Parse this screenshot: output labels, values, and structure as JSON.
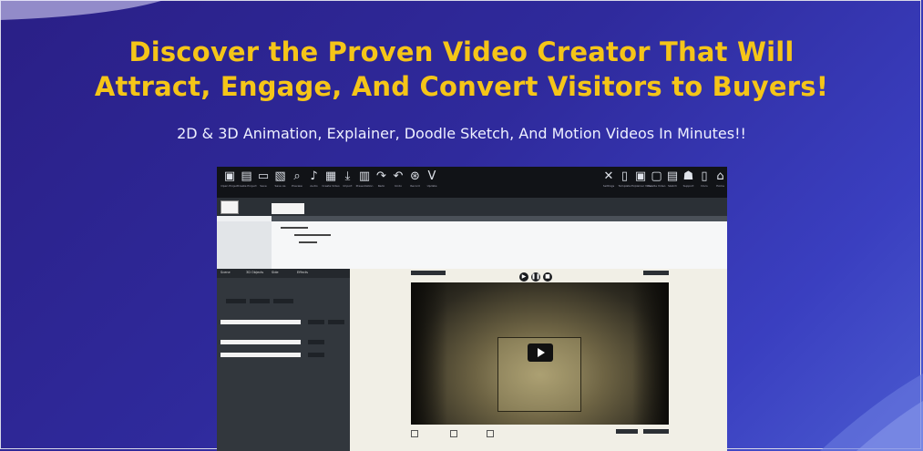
{
  "hero": {
    "title_line1": "Discover the Proven Video Creator That Will",
    "title_line2": "Attract, Engage, And Convert Visitors to Buyers!",
    "subtitle": "2D & 3D Animation, Explainer, Doodle Sketch, And Motion Videos In Minutes!!"
  },
  "colors": {
    "title": "#f5c518",
    "background_start": "#2a1f86",
    "background_end": "#4a5ad0",
    "app_toolbar": "#111317"
  },
  "app": {
    "toolbar_left": [
      {
        "icon": "open-project-icon",
        "glyph": "▣",
        "label": "Open Project"
      },
      {
        "icon": "create-project-icon",
        "glyph": "▤",
        "label": "Create Project"
      },
      {
        "icon": "save-icon",
        "glyph": "▭",
        "label": "Save"
      },
      {
        "icon": "save-as-icon",
        "glyph": "▧",
        "label": "Save As"
      },
      {
        "icon": "preview-icon",
        "glyph": "⌕",
        "label": "Preview"
      },
      {
        "icon": "audio-icon",
        "glyph": "♪",
        "label": "Audio"
      },
      {
        "icon": "create-video-icon",
        "glyph": "▦",
        "label": "Create Video"
      },
      {
        "icon": "import-icon",
        "glyph": "⤓",
        "label": "Import"
      },
      {
        "icon": "presentation-icon",
        "glyph": "▥",
        "label": "Presentation"
      },
      {
        "icon": "redo-icon",
        "glyph": "↷",
        "label": "Redo"
      },
      {
        "icon": "undo-icon",
        "glyph": "↶",
        "label": "Undo"
      },
      {
        "icon": "record-icon",
        "glyph": "⊛",
        "label": "Record"
      },
      {
        "icon": "version-icon",
        "glyph": "V",
        "label": "Update"
      }
    ],
    "toolbar_right": [
      {
        "icon": "settings-icon",
        "glyph": "✕",
        "label": "Settings"
      },
      {
        "icon": "template-icon",
        "glyph": "▯",
        "label": "Template"
      },
      {
        "icon": "explainer-icon",
        "glyph": "▣",
        "label": "Explainer Video"
      },
      {
        "icon": "doodle-icon",
        "glyph": "▢",
        "label": "Doodle Video"
      },
      {
        "icon": "sketch-icon",
        "glyph": "▤",
        "label": "Sketch"
      },
      {
        "icon": "support-icon",
        "glyph": "☗",
        "label": "Support"
      },
      {
        "icon": "docs-icon",
        "glyph": "▯",
        "label": "Docs"
      },
      {
        "icon": "home-icon",
        "glyph": "⌂",
        "label": "Home"
      }
    ],
    "left_tabs": [
      "Scene",
      "3D Objects",
      "Side",
      "Effects"
    ],
    "preview_controls": [
      "▶",
      "❚❚",
      "■"
    ]
  }
}
